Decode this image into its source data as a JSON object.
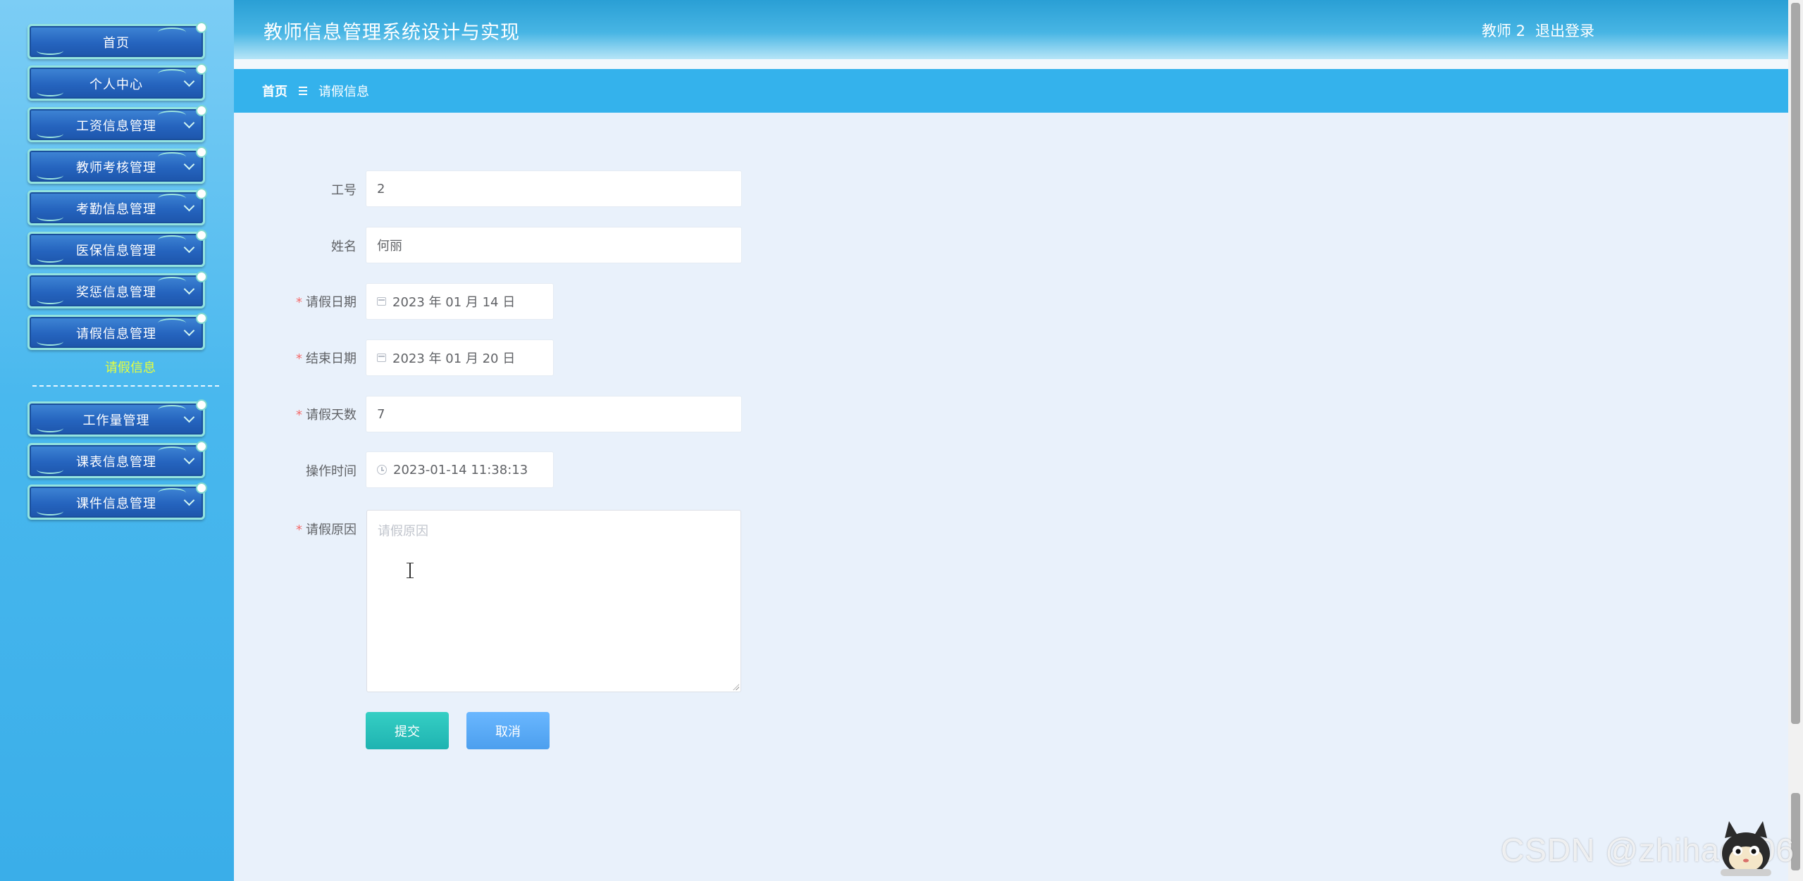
{
  "header": {
    "title": "教师信息管理系统设计与实现",
    "user": "教师 2",
    "logout": "退出登录"
  },
  "breadcrumb": {
    "home": "首页",
    "current": "请假信息"
  },
  "sidebar": {
    "items": [
      {
        "label": "首页"
      },
      {
        "label": "个人中心"
      },
      {
        "label": "工资信息管理"
      },
      {
        "label": "教师考核管理"
      },
      {
        "label": "考勤信息管理"
      },
      {
        "label": "医保信息管理"
      },
      {
        "label": "奖惩信息管理"
      },
      {
        "label": "请假信息管理"
      },
      {
        "label": "工作量管理"
      },
      {
        "label": "课表信息管理"
      },
      {
        "label": "课件信息管理"
      }
    ],
    "active_sub": "请假信息"
  },
  "form": {
    "job_no": {
      "label": "工号",
      "value": "2"
    },
    "name": {
      "label": "姓名",
      "value": "何丽"
    },
    "leave_date": {
      "label": "请假日期",
      "value": "2023 年 01 月 14 日"
    },
    "end_date": {
      "label": "结束日期",
      "value": "2023 年 01 月 20 日"
    },
    "days": {
      "label": "请假天数",
      "value": "7"
    },
    "op_time": {
      "label": "操作时间",
      "value": "2023-01-14 11:38:13"
    },
    "reason": {
      "label": "请假原因",
      "placeholder": "请假原因"
    },
    "required_mark": "*",
    "submit": "提交",
    "cancel": "取消"
  },
  "watermark": "CSDN @zhihao306",
  "colors": {
    "sidebar": "#49b8ee",
    "breadcrumb": "#34b2ec",
    "content_bg": "#e9f1fb",
    "submit": "#22b7b3",
    "cancel": "#56a6f2",
    "required": "#f56c6c",
    "active_sub": "#e8ff3a"
  }
}
